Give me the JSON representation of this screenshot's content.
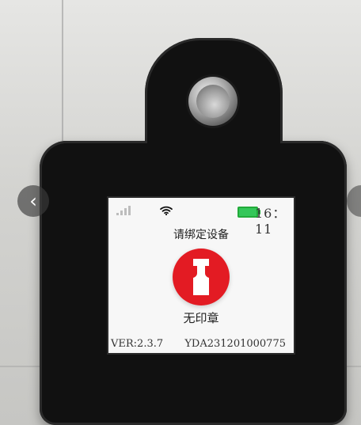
{
  "device": {
    "screen": {
      "status": {
        "time": "16：11",
        "battery_color": "#34c759"
      },
      "title": "请绑定设备",
      "stamp_status": "无印章",
      "footer": {
        "version": "VER:2.3.7",
        "serial": "YDA231201000775"
      },
      "accent_color": "#e31b23"
    }
  },
  "icons": {
    "nav_prev": "chevron-left-icon",
    "signal": "signal-icon",
    "wifi": "wifi-icon",
    "battery": "battery-icon",
    "stamp": "stamp-icon"
  }
}
